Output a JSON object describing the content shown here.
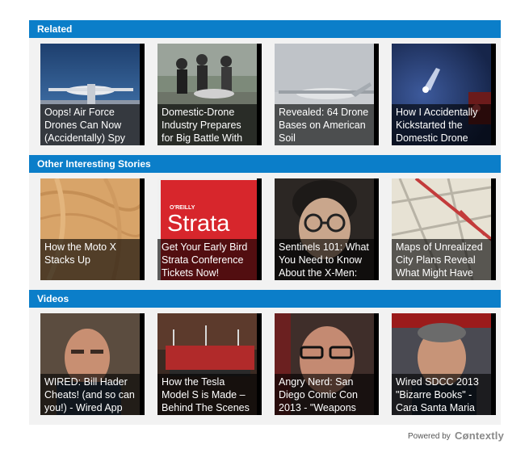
{
  "sections": [
    {
      "title": "Related",
      "cards": [
        {
          "caption": "Oops! Air Force Drones Can Now (Accidentally) Spy",
          "image": "drone-on-runway"
        },
        {
          "caption": "Domestic-Drone Industry Prepares for Big Battle With",
          "image": "people-with-drone"
        },
        {
          "caption": "Revealed: 64 Drone Bases on American Soil",
          "image": "drone-in-sky"
        },
        {
          "caption": "How I Accidentally Kickstarted the Domestic Drone",
          "image": "quadcopter-lights"
        }
      ]
    },
    {
      "title": "Other Interesting Stories",
      "cards": [
        {
          "caption": "How the Moto X Stacks Up",
          "image": "wood-texture"
        },
        {
          "caption": "Get Your Early Bird Strata Conference Tickets Now!",
          "image": "strata-logo",
          "logo_brand": "O'REILLY",
          "logo_word": "Strata"
        },
        {
          "caption": "Sentinels 101: What You Need to Know About the X-Men:",
          "image": "portrait-glasses"
        },
        {
          "caption": "Maps of Unrealized City Plans Reveal What Might Have",
          "image": "city-map"
        }
      ]
    },
    {
      "title": "Videos",
      "cards": [
        {
          "caption": "WIRED: Bill Hader Cheats! (and so can you!) - Wired App",
          "image": "bill-hader"
        },
        {
          "caption": "How the Tesla Model S is Made – Behind The Scenes",
          "image": "tesla-factory"
        },
        {
          "caption": "Angry Nerd: San Diego Comic Con 2013 - \"Weapons",
          "image": "angry-nerd"
        },
        {
          "caption": "Wired SDCC 2013 \"Bizarre Books\" - Cara Santa Maria",
          "image": "sdcc-man"
        }
      ]
    }
  ],
  "footer": {
    "powered_by": "Powered by",
    "brand": "Cøntextly"
  },
  "colors": {
    "header_bg": "#0b7ec9",
    "panel_bg": "#f2f2f2"
  }
}
